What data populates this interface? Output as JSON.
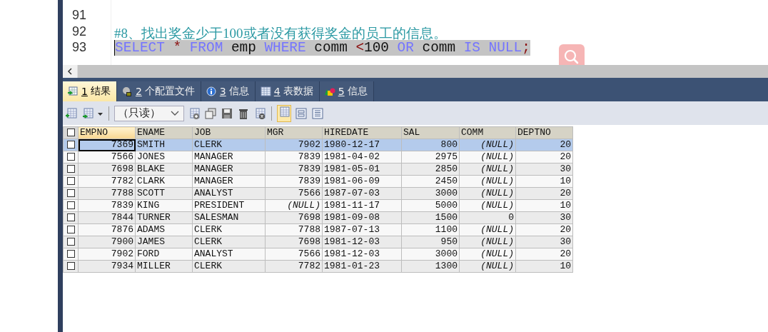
{
  "editor": {
    "lines": [
      {
        "number": "91"
      },
      {
        "number": "92",
        "tokens": [
          {
            "kind": "comment",
            "text": "#8、找出奖金少于100或者没有获得奖金的员工的信息。"
          }
        ]
      },
      {
        "number": "93",
        "selected": true,
        "tokens": [
          {
            "kind": "keyword",
            "text": "SELECT"
          },
          {
            "kind": "operator",
            "text": "*"
          },
          {
            "kind": "keyword",
            "text": "FROM"
          },
          {
            "kind": "plain",
            "text": "emp"
          },
          {
            "kind": "keyword",
            "text": "WHERE"
          },
          {
            "kind": "plain",
            "text": "comm"
          },
          {
            "kind": "operator",
            "text": "<"
          },
          {
            "kind": "plain",
            "text": "100",
            "joined": true
          },
          {
            "kind": "keyword",
            "text": "OR"
          },
          {
            "kind": "plain",
            "text": "comm"
          },
          {
            "kind": "keyword",
            "text": "IS"
          },
          {
            "kind": "keyword",
            "text": "NULL"
          },
          {
            "kind": "operator",
            "text": ";",
            "joined": true
          }
        ]
      }
    ]
  },
  "tabs": [
    {
      "key": "1",
      "label": "结果",
      "selected": true
    },
    {
      "key": "2",
      "label": "个配置文件",
      "selected": false
    },
    {
      "key": "3",
      "label": "信息",
      "selected": false
    },
    {
      "key": "4",
      "label": "表数据",
      "selected": false
    },
    {
      "key": "5",
      "label": "信息",
      "selected": false
    }
  ],
  "toolbar": {
    "mode_select": {
      "value": "（只读）"
    }
  },
  "table": {
    "select_all_checked": false,
    "columns": [
      "EMPNO",
      "ENAME",
      "JOB",
      "MGR",
      "HIREDATE",
      "SAL",
      "COMM",
      "DEPTNO"
    ],
    "rows": [
      {
        "selected": true,
        "checked": false,
        "cells": [
          "7369",
          "SMITH",
          "CLERK",
          "7902",
          "1980-12-17",
          "800",
          {
            "kind": "null",
            "text": "(NULL)"
          },
          "20"
        ]
      },
      {
        "selected": false,
        "checked": false,
        "cells": [
          "7566",
          "JONES",
          "MANAGER",
          "7839",
          "1981-04-02",
          "2975",
          {
            "kind": "null",
            "text": "(NULL)"
          },
          "20"
        ]
      },
      {
        "selected": false,
        "checked": false,
        "cells": [
          "7698",
          "BLAKE",
          "MANAGER",
          "7839",
          "1981-05-01",
          "2850",
          {
            "kind": "null",
            "text": "(NULL)"
          },
          "30"
        ]
      },
      {
        "selected": false,
        "checked": false,
        "cells": [
          "7782",
          "CLARK",
          "MANAGER",
          "7839",
          "1981-06-09",
          "2450",
          {
            "kind": "null",
            "text": "(NULL)"
          },
          "10"
        ]
      },
      {
        "selected": false,
        "checked": false,
        "cells": [
          "7788",
          "SCOTT",
          "ANALYST",
          "7566",
          "1987-07-03",
          "3000",
          {
            "kind": "null",
            "text": "(NULL)"
          },
          "20"
        ]
      },
      {
        "selected": false,
        "checked": false,
        "cells": [
          "7839",
          "KING",
          "PRESIDENT",
          {
            "kind": "null",
            "text": "(NULL)"
          },
          "1981-11-17",
          "5000",
          {
            "kind": "null",
            "text": "(NULL)"
          },
          "10"
        ]
      },
      {
        "selected": false,
        "checked": false,
        "cells": [
          "7844",
          "TURNER",
          "SALESMAN",
          "7698",
          "1981-09-08",
          "1500",
          "0",
          "30"
        ]
      },
      {
        "selected": false,
        "checked": false,
        "cells": [
          "7876",
          "ADAMS",
          "CLERK",
          "7788",
          "1987-07-13",
          "1100",
          {
            "kind": "null",
            "text": "(NULL)"
          },
          "20"
        ]
      },
      {
        "selected": false,
        "checked": false,
        "cells": [
          "7900",
          "JAMES",
          "CLERK",
          "7698",
          "1981-12-03",
          "950",
          {
            "kind": "null",
            "text": "(NULL)"
          },
          "30"
        ]
      },
      {
        "selected": false,
        "checked": false,
        "cells": [
          "7902",
          "FORD",
          "ANALYST",
          "7566",
          "1981-12-03",
          "3000",
          {
            "kind": "null",
            "text": "(NULL)"
          },
          "20"
        ]
      },
      {
        "selected": false,
        "checked": false,
        "cells": [
          "7934",
          "MILLER",
          "CLERK",
          "7782",
          "1981-01-23",
          "1300",
          {
            "kind": "null",
            "text": "(NULL)"
          },
          "10"
        ]
      }
    ]
  }
}
